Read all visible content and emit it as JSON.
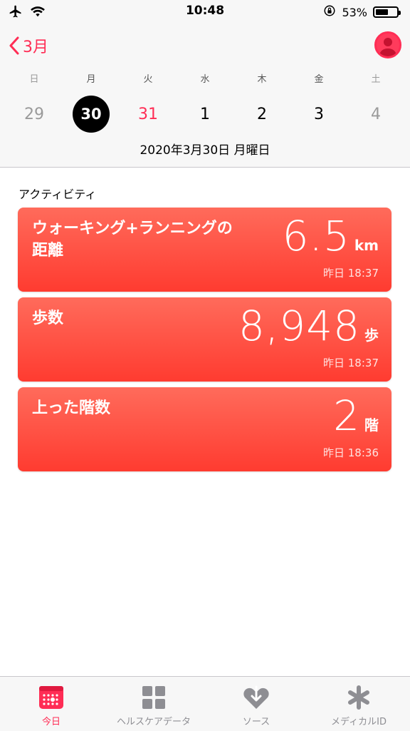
{
  "status_bar": {
    "time": "10:48",
    "battery_percent": "53%",
    "icons": [
      "airplane-icon",
      "wifi-icon",
      "rotation-lock-icon",
      "battery-icon"
    ]
  },
  "header": {
    "back_label": "3月",
    "weekdays": [
      "日",
      "月",
      "火",
      "水",
      "木",
      "金",
      "土"
    ],
    "dates": [
      "29",
      "30",
      "31",
      "1",
      "2",
      "3",
      "4"
    ],
    "selected_index": 1,
    "today_index": 2,
    "full_date": "2020年3月30日 月曜日"
  },
  "section": {
    "title": "アクティビティ"
  },
  "cards": [
    {
      "title": "ウォーキング+ランニングの距離",
      "value": "6.5",
      "unit": "km",
      "time": "昨日 18:37"
    },
    {
      "title": "歩数",
      "value": "8,948",
      "unit": "歩",
      "time": "昨日 18:37"
    },
    {
      "title": "上った階数",
      "value": "2",
      "unit": "階",
      "time": "昨日 18:36"
    }
  ],
  "tabs": [
    {
      "label": "今日",
      "icon": "calendar-icon",
      "active": true
    },
    {
      "label": "ヘルスケアデータ",
      "icon": "grid-icon",
      "active": false
    },
    {
      "label": "ソース",
      "icon": "heart-download-icon",
      "active": false
    },
    {
      "label": "メディカルID",
      "icon": "asterisk-icon",
      "active": false
    }
  ],
  "colors": {
    "accent": "#ff2d55",
    "card_top": "#ff6b5b",
    "card_bottom": "#ff3b30"
  }
}
